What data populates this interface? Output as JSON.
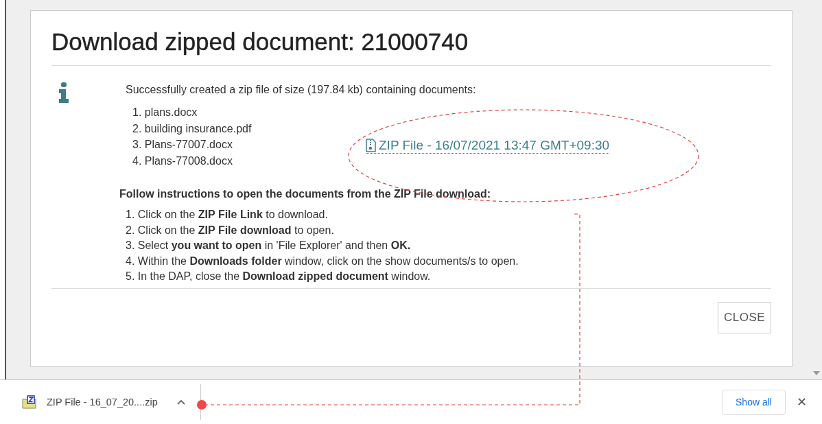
{
  "dialog": {
    "title": "Download zipped document: 21000740",
    "message": "Successfully created a zip file of size (197.84 kb) containing documents:",
    "documents": [
      "1. plans.docx",
      "2. building insurance.pdf",
      "3. Plans-77007.docx",
      "4. Plans-77008.docx"
    ],
    "zip_link": "ZIP File - 16/07/2021 13:47 GMT+09:30",
    "instructions_heading": "Follow instructions to open the documents from the ZIP File download:",
    "instructions": [
      "1. Click on the **ZIP File Link** to download.",
      "2. Click on the **ZIP File download** to open.",
      "3. Select **you want to open** in 'File Explorer' and then **OK.**",
      "4. Within the **Downloads folder** window, click on the show documents/s to open.",
      "5. In the DAP, close the **Download zipped document** window."
    ],
    "close_button": "CLOSE"
  },
  "download_bar": {
    "file": "ZIP File - 16_07_20....zip",
    "show_all": "Show all",
    "close": "✕"
  }
}
